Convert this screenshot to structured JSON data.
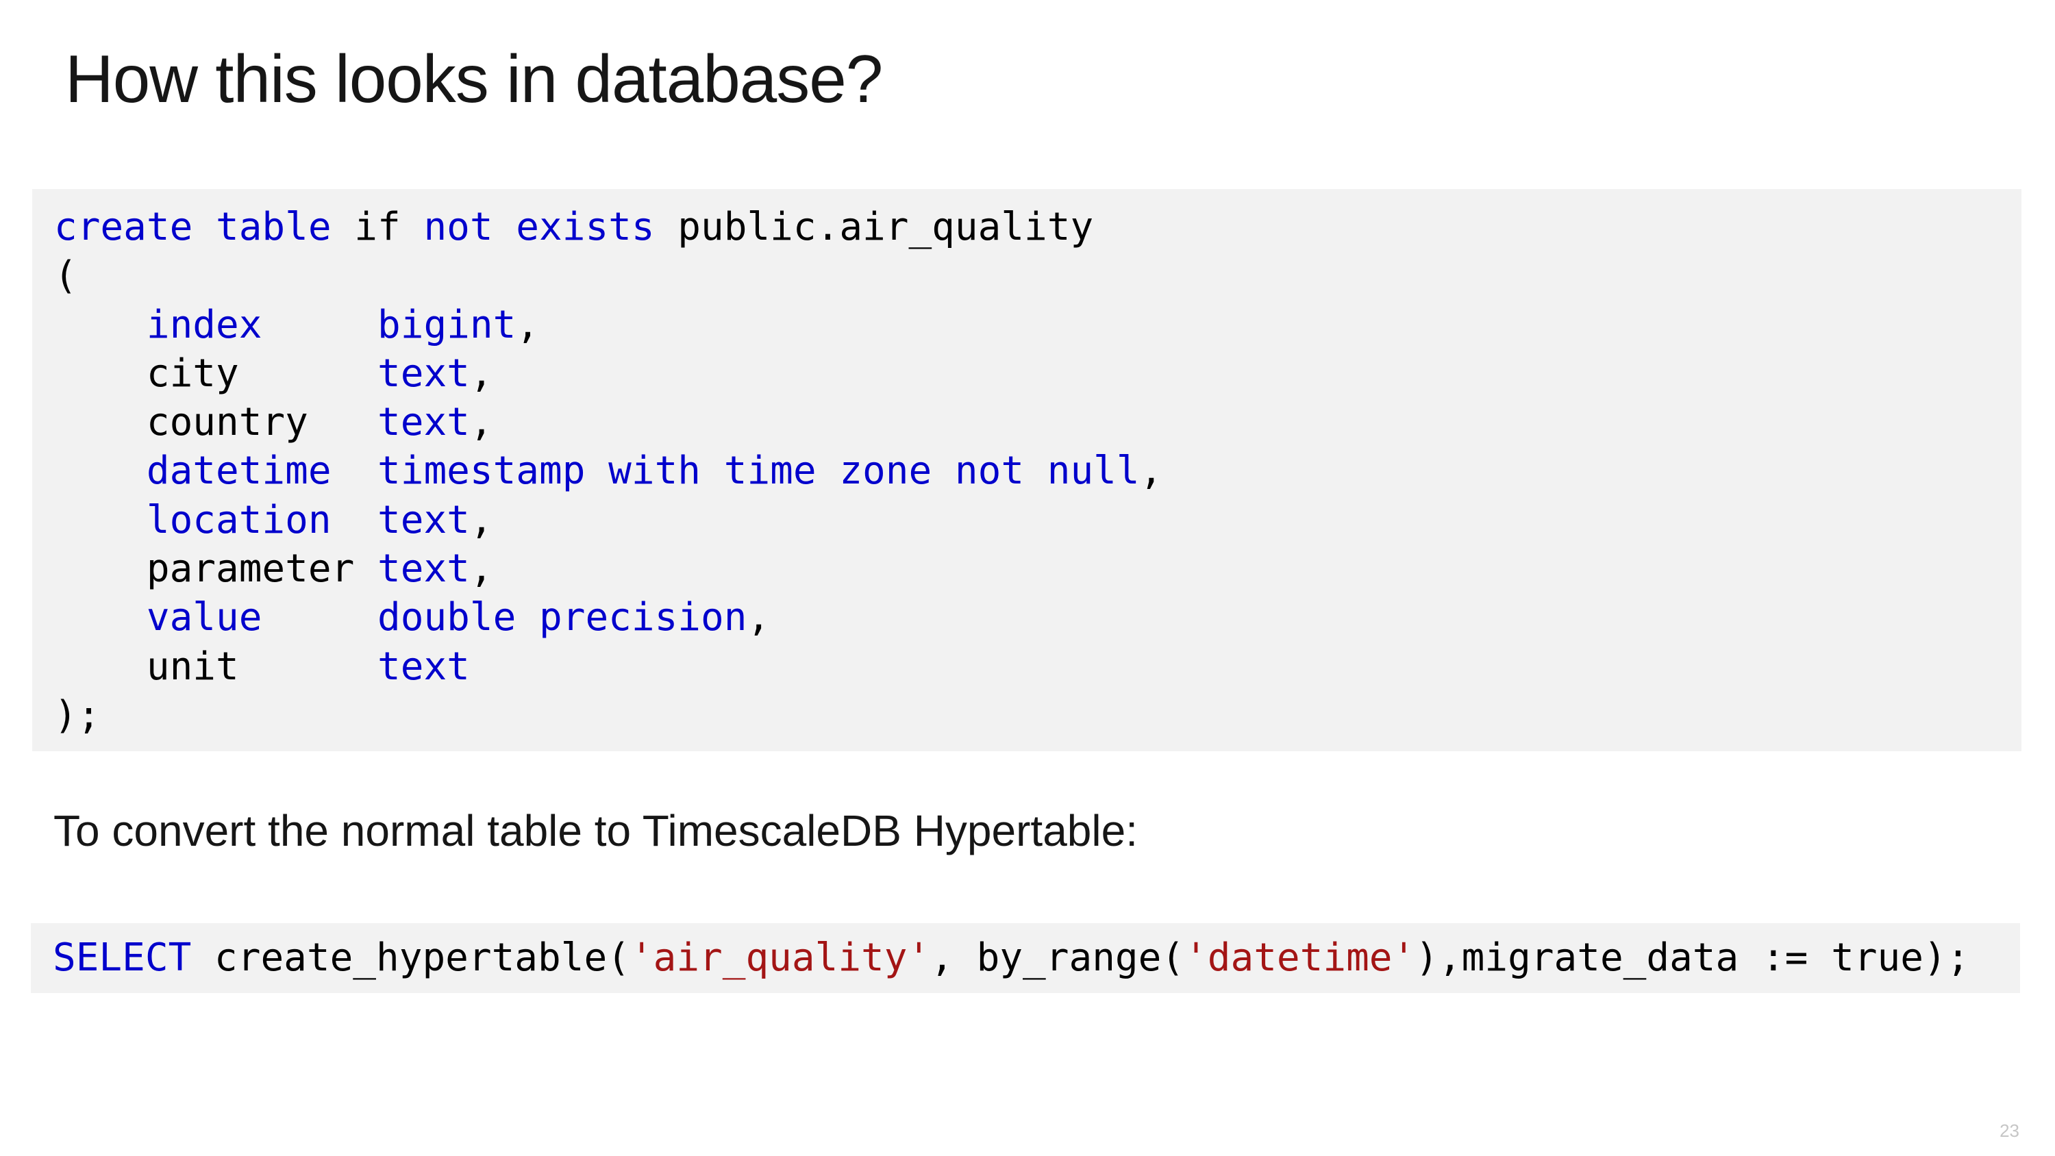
{
  "slide": {
    "title": "How this looks in database?",
    "page_number": "23"
  },
  "create_code": {
    "lines": [
      {
        "tokens": [
          {
            "text": "create table",
            "kind": "keyword"
          },
          {
            "text": " if ",
            "kind": "plain"
          },
          {
            "text": "not exists",
            "kind": "keyword"
          },
          {
            "text": " public.air_quality",
            "kind": "plain"
          }
        ]
      },
      {
        "tokens": [
          {
            "text": "(",
            "kind": "plain"
          }
        ]
      },
      {
        "tokens": [
          {
            "text": "    ",
            "kind": "plain"
          },
          {
            "text": "index",
            "kind": "keyword"
          },
          {
            "text": "     ",
            "kind": "plain"
          },
          {
            "text": "bigint",
            "kind": "keyword"
          },
          {
            "text": ",",
            "kind": "plain"
          }
        ]
      },
      {
        "tokens": [
          {
            "text": "    city      ",
            "kind": "plain"
          },
          {
            "text": "text",
            "kind": "keyword"
          },
          {
            "text": ",",
            "kind": "plain"
          }
        ]
      },
      {
        "tokens": [
          {
            "text": "    country   ",
            "kind": "plain"
          },
          {
            "text": "text",
            "kind": "keyword"
          },
          {
            "text": ",",
            "kind": "plain"
          }
        ]
      },
      {
        "tokens": [
          {
            "text": "    ",
            "kind": "plain"
          },
          {
            "text": "datetime",
            "kind": "keyword"
          },
          {
            "text": "  ",
            "kind": "plain"
          },
          {
            "text": "timestamp with time zone not null",
            "kind": "keyword"
          },
          {
            "text": ",",
            "kind": "plain"
          }
        ]
      },
      {
        "tokens": [
          {
            "text": "    ",
            "kind": "plain"
          },
          {
            "text": "location",
            "kind": "keyword"
          },
          {
            "text": "  ",
            "kind": "plain"
          },
          {
            "text": "text",
            "kind": "keyword"
          },
          {
            "text": ",",
            "kind": "plain"
          }
        ]
      },
      {
        "tokens": [
          {
            "text": "    parameter ",
            "kind": "plain"
          },
          {
            "text": "text",
            "kind": "keyword"
          },
          {
            "text": ",",
            "kind": "plain"
          }
        ]
      },
      {
        "tokens": [
          {
            "text": "    ",
            "kind": "plain"
          },
          {
            "text": "value",
            "kind": "keyword"
          },
          {
            "text": "     ",
            "kind": "plain"
          },
          {
            "text": "double precision",
            "kind": "keyword"
          },
          {
            "text": ",",
            "kind": "plain"
          }
        ]
      },
      {
        "tokens": [
          {
            "text": "    unit      ",
            "kind": "plain"
          },
          {
            "text": "text",
            "kind": "keyword"
          }
        ]
      },
      {
        "tokens": [
          {
            "text": ");",
            "kind": "plain"
          }
        ]
      }
    ]
  },
  "convert_text": "To convert the normal table to TimescaleDB Hypertable:",
  "select_code": {
    "tokens": [
      {
        "text": "SELECT",
        "kind": "keyword"
      },
      {
        "text": " create_hypertable(",
        "kind": "plain"
      },
      {
        "text": "'air_quality'",
        "kind": "string"
      },
      {
        "text": ", by_range(",
        "kind": "plain"
      },
      {
        "text": "'datetime'",
        "kind": "string"
      },
      {
        "text": "),migrate_data := true);",
        "kind": "plain"
      }
    ]
  },
  "colors": {
    "keyword": "#0000cc",
    "string": "#a31515",
    "plain": "#000000",
    "code_background": "#f2f2f2"
  }
}
